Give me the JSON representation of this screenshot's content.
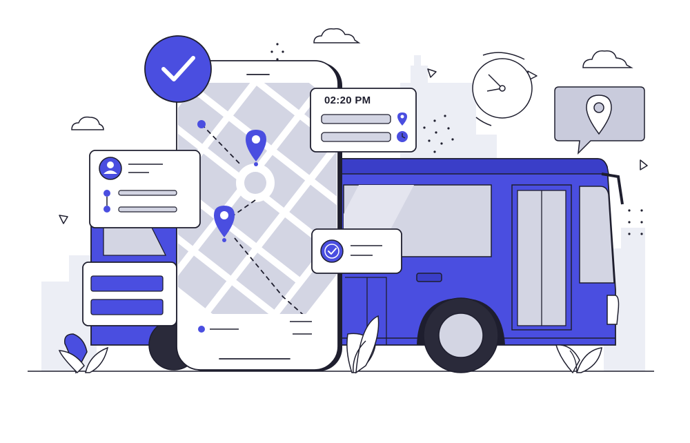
{
  "schedule_card": {
    "time": "02:20 PM"
  },
  "colors": {
    "accent": "#4a4ee0",
    "accent_dark": "#3a3ec8",
    "outline": "#1e1e2e",
    "light_gray": "#d3d5e3",
    "mid_gray": "#b9bccd",
    "background_city": "#eceef5",
    "white": "#ffffff"
  },
  "icons": {
    "check_badge": "check-circle-icon",
    "map_pin": "map-pin-icon",
    "clock": "clock-icon",
    "user": "user-avatar-icon",
    "location_bubble": "location-bubble-icon"
  }
}
